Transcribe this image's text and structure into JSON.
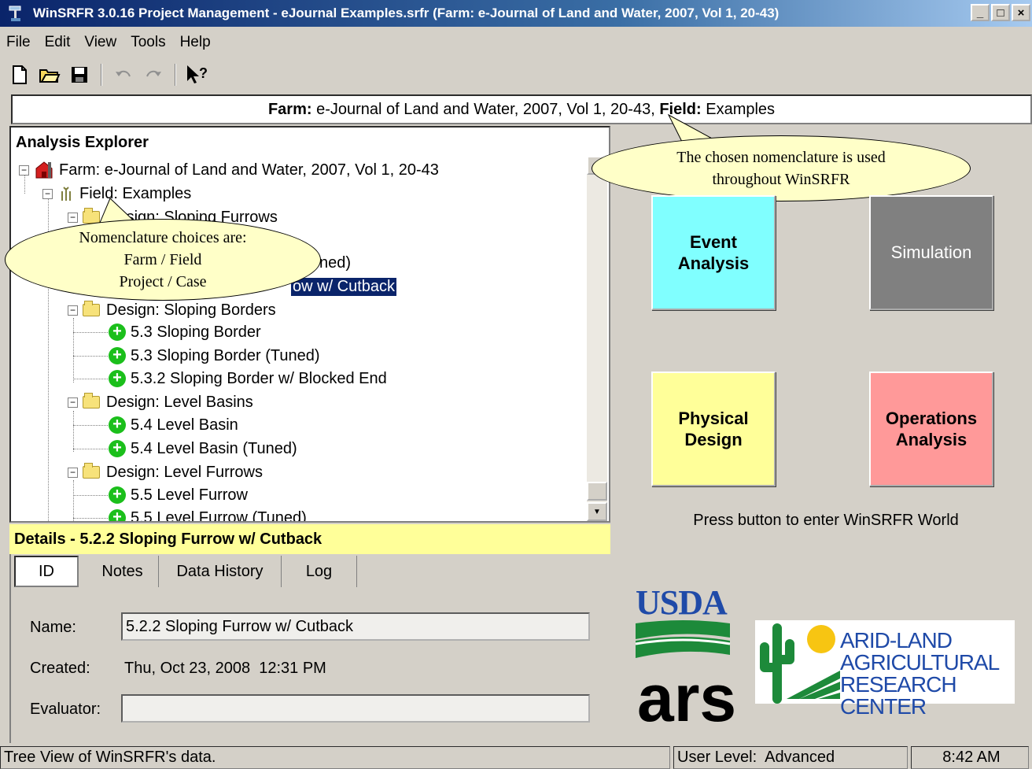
{
  "window": {
    "title": "WinSRFR 3.0.16 Project Management - eJournal Examples.srfr (Farm: e-Journal of Land and Water, 2007, Vol 1, 20-43)",
    "minimize": "_",
    "maximize": "□",
    "close": "×"
  },
  "menu": {
    "file": "File",
    "edit": "Edit",
    "view": "View",
    "tools": "Tools",
    "help": "Help"
  },
  "toolbar": {
    "icons": [
      "new-file-icon",
      "open-folder-icon",
      "save-icon",
      "undo-icon",
      "redo-icon",
      "context-help-icon"
    ]
  },
  "infobar": {
    "farm_label": "Farm:",
    "farm_value": "e-Journal of Land and Water, 2007, Vol 1, 20-43,",
    "field_label": "Field:",
    "field_value": "Examples"
  },
  "explorer": {
    "title": "Analysis Explorer",
    "farm": "Farm: e-Journal of Land and Water, 2007, Vol 1, 20-43",
    "field": "Field: Examples",
    "project1": "Design: Sloping Furrows",
    "case_1_2_visible": "ned)",
    "case_1_3_visible": "ow w/ Cutback",
    "project2": "Design: Sloping Borders",
    "case2_1": "5.3 Sloping Border",
    "case2_2": "5.3 Sloping Border (Tuned)",
    "case2_3": "5.3.2 Sloping Border w/ Blocked End",
    "project3": "Design: Level Basins",
    "case3_1": "5.4 Level Basin",
    "case3_2": "5.4 Level Basin (Tuned)",
    "project4": "Design: Level Furrows",
    "case4_1": "5.5 Level Furrow",
    "case4_2": "5.5 Level Furrow (Tuned)"
  },
  "callouts": {
    "nomenclature_line1": "Nomenclature choices are:",
    "nomenclature_line2": "Farm / Field",
    "nomenclature_line3": "Project / Case",
    "chosen_line1": "The chosen nomenclature is used",
    "chosen_line2": "throughout WinSRFR"
  },
  "details": {
    "header": "Details - 5.2.2 Sloping Furrow w/ Cutback",
    "tabs": [
      "ID",
      "Notes",
      "Data History",
      "Log"
    ],
    "name_label": "Name:",
    "name_value": "5.2.2 Sloping Furrow w/ Cutback",
    "created_label": "Created:",
    "created_value": "Thu, Oct 23, 2008  12:31 PM",
    "evaluator_label": "Evaluator:",
    "evaluator_value": ""
  },
  "world": {
    "event_analysis": "Event Analysis",
    "simulation": "Simulation",
    "physical_design": "Physical Design",
    "operations_analysis": "Operations Analysis",
    "prompt": "Press button to enter WinSRFR World",
    "colors": {
      "event_analysis": "#80ffff",
      "simulation": "#808080",
      "physical_design": "#ffff99",
      "operations_analysis": "#ff9999"
    }
  },
  "logos": {
    "usda": "USDA",
    "ars": "ars",
    "aridland_line1": "ARID-LAND",
    "aridland_line2": "AGRICULTURAL",
    "aridland_line3": "RESEARCH CENTER"
  },
  "status": {
    "message": "Tree View of WinSRFR's data.",
    "user_level": "User Level:  Advanced",
    "time": "8:42 AM"
  }
}
